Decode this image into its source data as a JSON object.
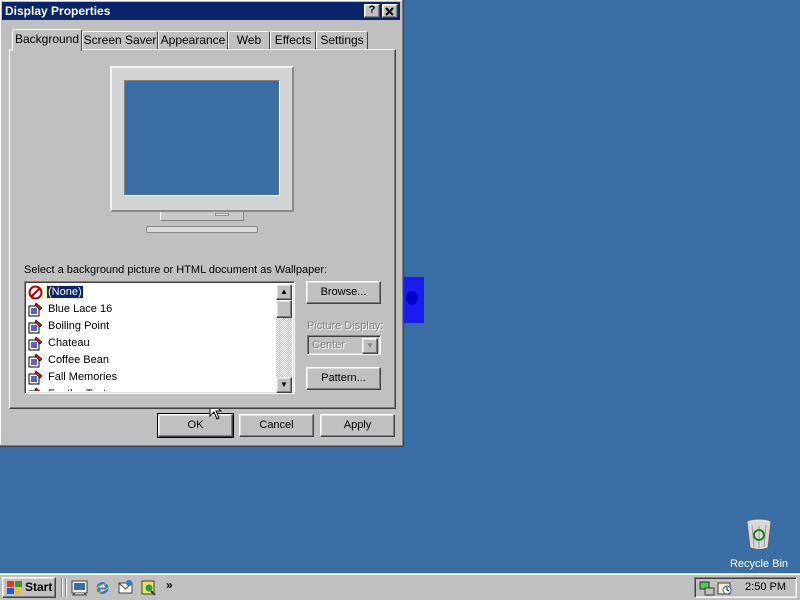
{
  "window": {
    "title": "Display Properties",
    "help_button": "?",
    "close_button": "✕"
  },
  "tabs": [
    {
      "label": "Background",
      "active": true
    },
    {
      "label": "Screen Saver",
      "active": false
    },
    {
      "label": "Appearance",
      "active": false
    },
    {
      "label": "Web",
      "active": false
    },
    {
      "label": "Effects",
      "active": false
    },
    {
      "label": "Settings",
      "active": false
    }
  ],
  "preview": {
    "screen_color": "#3a6ea5"
  },
  "wallpaper": {
    "label": "Select a background picture or HTML document as Wallpaper:",
    "items": [
      {
        "label": "(None)",
        "icon": "none-icon",
        "selected": true
      },
      {
        "label": "Blue Lace 16",
        "icon": "paint-icon",
        "selected": false
      },
      {
        "label": "Boiling Point",
        "icon": "paint-icon",
        "selected": false
      },
      {
        "label": "Chateau",
        "icon": "paint-icon",
        "selected": false
      },
      {
        "label": "Coffee Bean",
        "icon": "paint-icon",
        "selected": false
      },
      {
        "label": "Fall Memories",
        "icon": "paint-icon",
        "selected": false
      },
      {
        "label": "FeatherTexture",
        "icon": "paint-icon",
        "selected": false
      }
    ],
    "browse_button": "Browse...",
    "picture_display_label": "Picture Display:",
    "picture_display_value": "Center",
    "pattern_button": "Pattern..."
  },
  "buttons": {
    "ok": "OK",
    "cancel": "Cancel",
    "apply": "Apply"
  },
  "desktop": {
    "background_color": "#3a6ea5",
    "recycle_bin_label": "Recycle Bin"
  },
  "taskbar": {
    "start_label": "Start",
    "quick_launch": [
      "show-desktop-icon",
      "internet-explorer-icon",
      "outlook-express-icon",
      "channels-icon"
    ],
    "more_label": "»",
    "tray_icons": [
      "network-icon",
      "scheduler-icon"
    ],
    "clock": "2:50 PM"
  }
}
